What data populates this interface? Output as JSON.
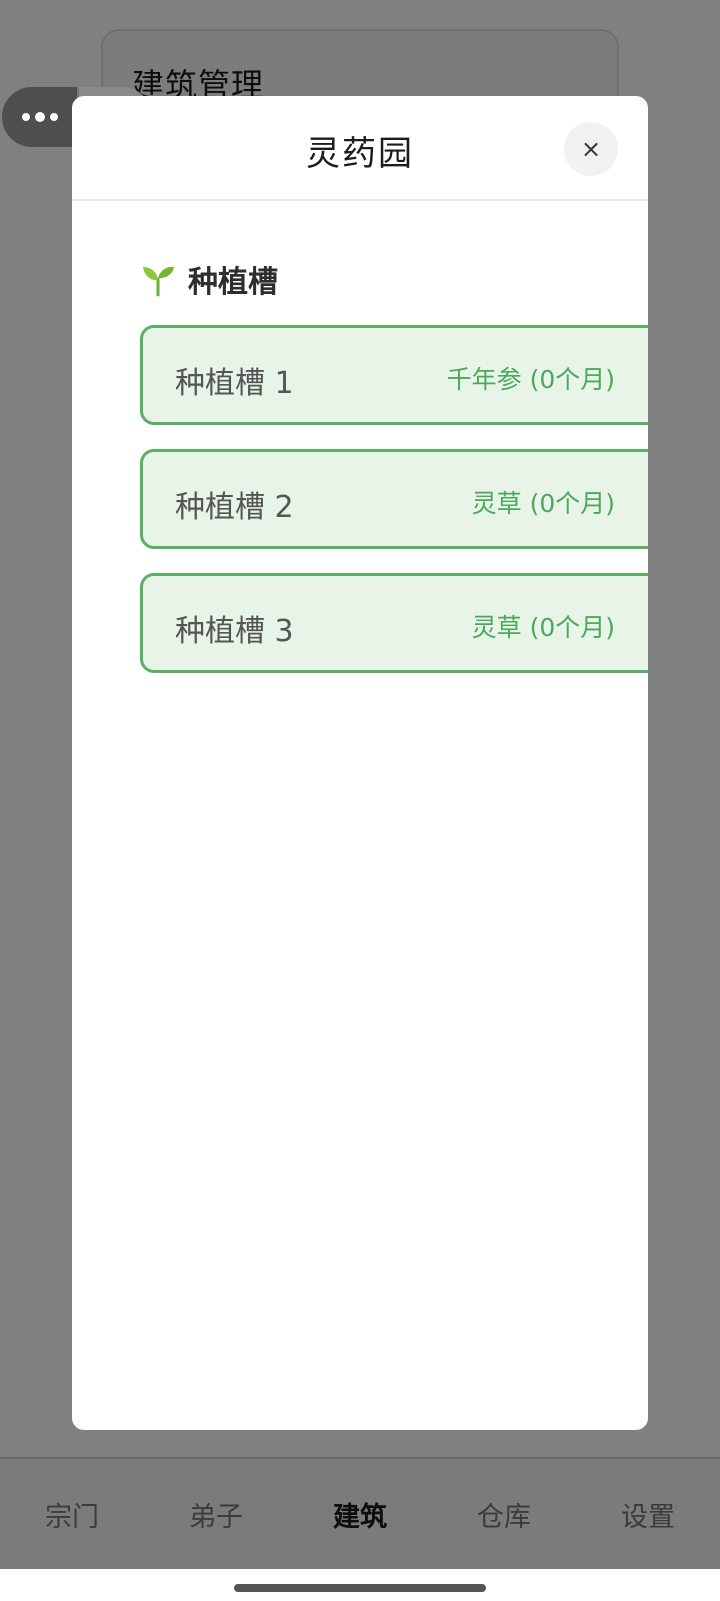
{
  "background": {
    "card_title": "建筑管理"
  },
  "modal": {
    "title": "灵药园",
    "close_label": "×",
    "section_title": "种植槽",
    "slots": [
      {
        "name": "种植槽 1",
        "status": "千年参 (0个月)"
      },
      {
        "name": "种植槽 2",
        "status": "灵草 (0个月)"
      },
      {
        "name": "种植槽 3",
        "status": "灵草 (0个月)"
      }
    ]
  },
  "tabbar": {
    "tabs": [
      {
        "label": "宗门"
      },
      {
        "label": "弟子"
      },
      {
        "label": "建筑",
        "active": true
      },
      {
        "label": "仓库"
      },
      {
        "label": "设置"
      }
    ]
  },
  "icons": {
    "section": "sprout-icon",
    "capsule_left": "more-dots-icon",
    "capsule_right": "target-icon"
  },
  "colors": {
    "accent": "#5bb063",
    "slot_background": "#e8f4e8",
    "overlay": "#808080"
  }
}
